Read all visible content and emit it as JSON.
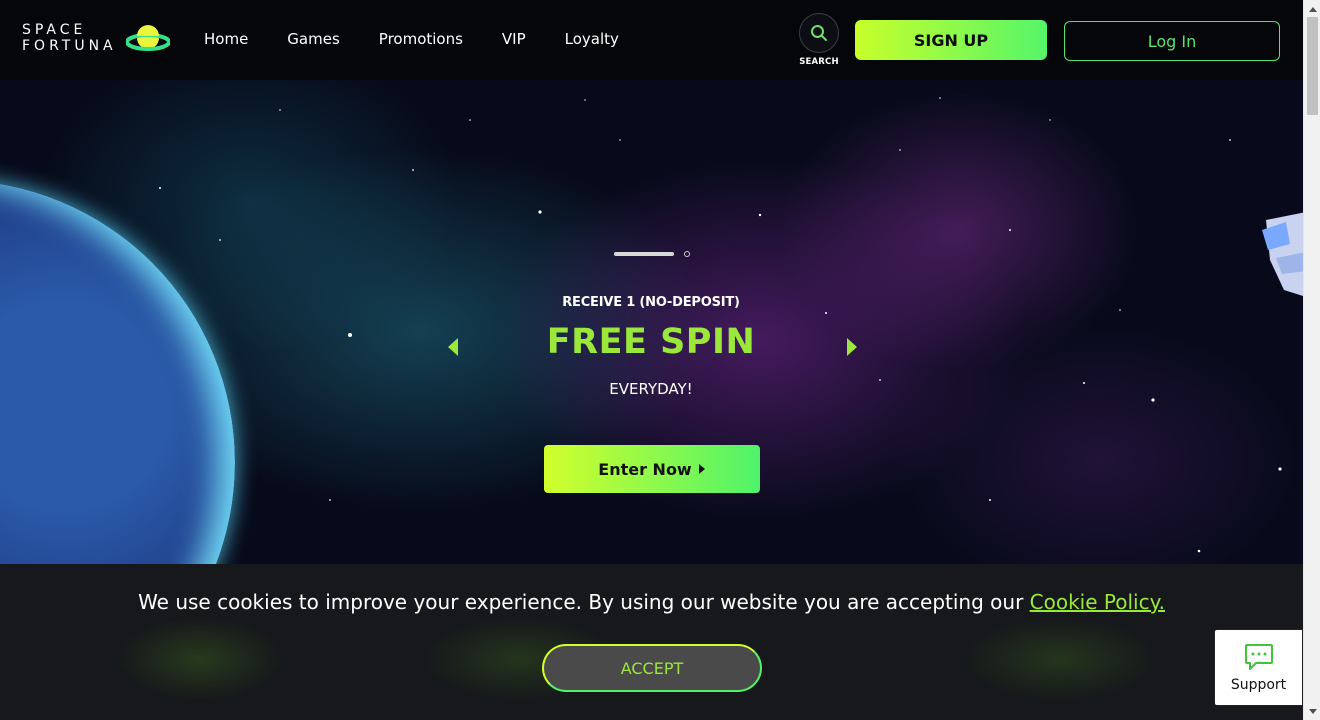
{
  "brand": {
    "line1": "SPACE",
    "line2": "FORTUNA"
  },
  "nav": [
    "Home",
    "Games",
    "Promotions",
    "VIP",
    "Loyalty"
  ],
  "header": {
    "search_label": "SEARCH",
    "signup_label": "SIGN UP",
    "login_label": "Log In"
  },
  "hero": {
    "slide_count": 2,
    "active_slide": 1,
    "pre_title": "RECEIVE 1 (NO-DEPOSIT)",
    "title": "FREE SPIN",
    "subtitle": "EVERYDAY!",
    "cta_label": "Enter Now"
  },
  "cookie": {
    "text": "We use cookies to improve your experience. By using our website you are accepting our",
    "link_text": "Cookie Policy.",
    "accept_label": "ACCEPT"
  },
  "support": {
    "label": "Support"
  },
  "colors": {
    "accent_green": "#9be83a",
    "button_gradient_start": "#d2ff2c",
    "button_gradient_end": "#4ef36a",
    "login_border": "#5ae36a"
  },
  "icons": [
    "search-icon",
    "chevron-left-icon",
    "chevron-right-icon",
    "play-triangle-icon",
    "chat-icon",
    "scroll-up-icon",
    "scroll-down-icon"
  ]
}
